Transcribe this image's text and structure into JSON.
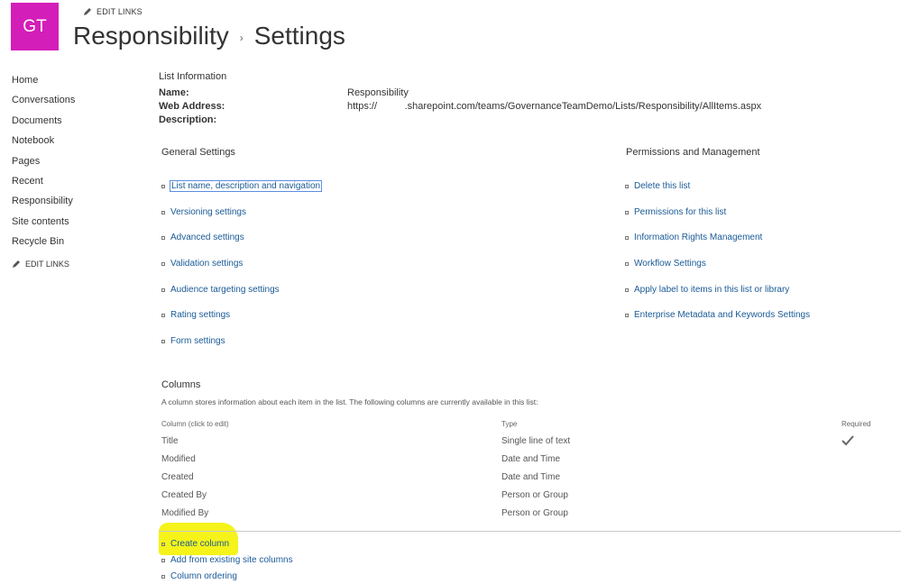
{
  "site": {
    "logo_text": "GT",
    "logo_color": "#d41eb9",
    "edit_links": "EDIT LINKS",
    "title_list": "Responsibility",
    "title_separator": "›",
    "title_page": "Settings"
  },
  "nav": {
    "items": [
      "Home",
      "Conversations",
      "Documents",
      "Notebook",
      "Pages",
      "Recent",
      "Responsibility",
      "Site contents",
      "Recycle Bin"
    ],
    "edit_links": "EDIT LINKS"
  },
  "list_info": {
    "heading": "List Information",
    "name_label": "Name:",
    "name_value": "Responsibility",
    "web_label": "Web Address:",
    "web_value": "https://          .sharepoint.com/teams/GovernanceTeamDemo/Lists/Responsibility/AllItems.aspx",
    "desc_label": "Description:",
    "desc_value": ""
  },
  "general_settings": {
    "heading": "General Settings",
    "links": [
      "List name, description and navigation",
      "Versioning settings",
      "Advanced settings",
      "Validation settings",
      "Audience targeting settings",
      "Rating settings",
      "Form settings"
    ]
  },
  "permissions": {
    "heading": "Permissions and Management",
    "links": [
      "Delete this list",
      "Permissions for this list",
      "Information Rights Management",
      "Workflow Settings",
      "Apply label to items in this list or library",
      "Enterprise Metadata and Keywords Settings"
    ]
  },
  "columns": {
    "heading": "Columns",
    "description": "A column stores information about each item in the list. The following columns are currently available in this list:",
    "headers": {
      "column": "Column (click to edit)",
      "type": "Type",
      "required": "Required"
    },
    "rows": [
      {
        "name": "Title",
        "type": "Single line of text",
        "required": true
      },
      {
        "name": "Modified",
        "type": "Date and Time",
        "required": false
      },
      {
        "name": "Created",
        "type": "Date and Time",
        "required": false
      },
      {
        "name": "Created By",
        "type": "Person or Group",
        "required": false
      },
      {
        "name": "Modified By",
        "type": "Person or Group",
        "required": false
      }
    ],
    "actions": [
      "Create column",
      "Add from existing site columns",
      "Column ordering"
    ],
    "highlight_color": "#f5f31a"
  },
  "icons": [
    "pencil-icon",
    "bullet-icon",
    "checkmark-icon"
  ]
}
